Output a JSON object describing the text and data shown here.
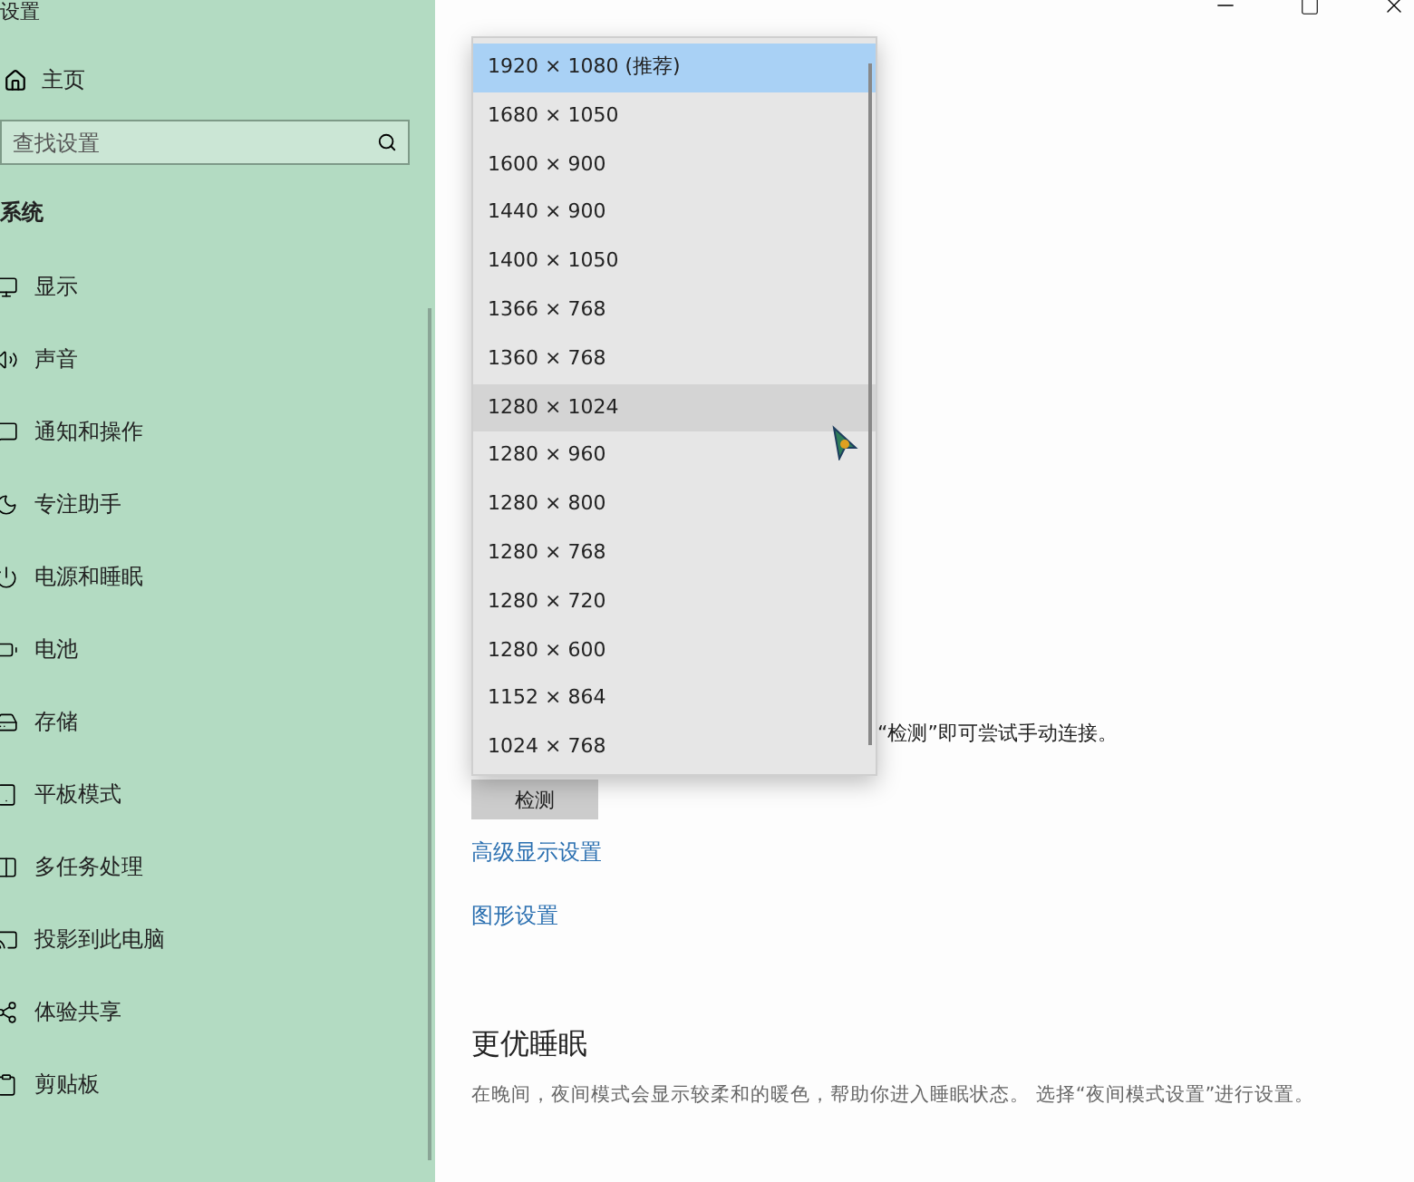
{
  "window": {
    "title": "设置"
  },
  "sidebar": {
    "home": "主页",
    "search": {
      "placeholder": "查找设置"
    },
    "section": "系统",
    "items": [
      {
        "label": "显示"
      },
      {
        "label": "声音"
      },
      {
        "label": "通知和操作"
      },
      {
        "label": "专注助手"
      },
      {
        "label": "电源和睡眠"
      },
      {
        "label": "电池"
      },
      {
        "label": "存储"
      },
      {
        "label": "平板模式"
      },
      {
        "label": "多任务处理"
      },
      {
        "label": "投影到此电脑"
      },
      {
        "label": "体验共享"
      },
      {
        "label": "剪贴板"
      }
    ]
  },
  "content": {
    "detect_hint": "“检测”即可尝试手动连接。",
    "detect_button": "检测",
    "links": [
      "高级显示设置",
      "图形设置"
    ],
    "sleep_heading": "更优睡眠",
    "sleep_text": "在晚间，夜间模式会显示较柔和的暖色，帮助你进入睡眠状态。 选择“夜间模式设置”进行设置。"
  },
  "resolution_dropdown": {
    "options": [
      {
        "label": "1920 × 1080 (推荐)",
        "selected": true,
        "hovered": false
      },
      {
        "label": "1680 × 1050",
        "selected": false,
        "hovered": false
      },
      {
        "label": "1600 × 900",
        "selected": false,
        "hovered": false
      },
      {
        "label": "1440 × 900",
        "selected": false,
        "hovered": false
      },
      {
        "label": "1400 × 1050",
        "selected": false,
        "hovered": false
      },
      {
        "label": "1366 × 768",
        "selected": false,
        "hovered": false
      },
      {
        "label": "1360 × 768",
        "selected": false,
        "hovered": false
      },
      {
        "label": "1280 × 1024",
        "selected": false,
        "hovered": true
      },
      {
        "label": "1280 × 960",
        "selected": false,
        "hovered": false
      },
      {
        "label": "1280 × 800",
        "selected": false,
        "hovered": false
      },
      {
        "label": "1280 × 768",
        "selected": false,
        "hovered": false
      },
      {
        "label": "1280 × 720",
        "selected": false,
        "hovered": false
      },
      {
        "label": "1280 × 600",
        "selected": false,
        "hovered": false
      },
      {
        "label": "1152 × 864",
        "selected": false,
        "hovered": false
      },
      {
        "label": "1024 × 768",
        "selected": false,
        "hovered": false
      }
    ]
  }
}
